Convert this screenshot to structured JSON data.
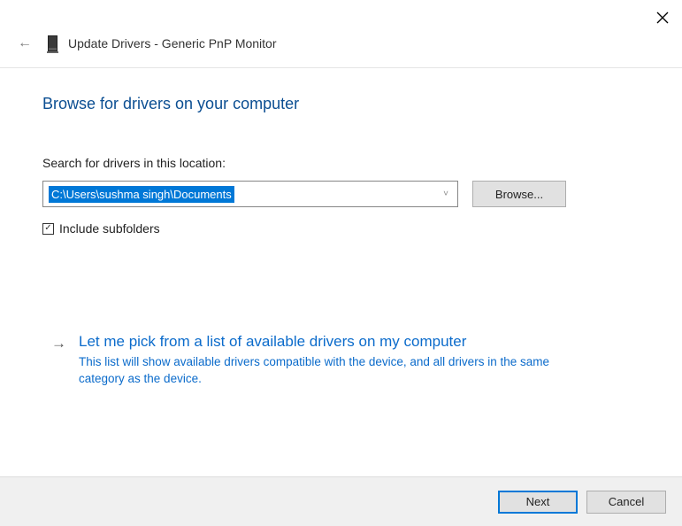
{
  "window": {
    "title": "Update Drivers - Generic PnP Monitor"
  },
  "page": {
    "title": "Browse for drivers on your computer",
    "search_label": "Search for drivers in this location:",
    "path_value": "C:\\Users\\sushma singh\\Documents",
    "browse_button": "Browse...",
    "include_subfolders_label": "Include subfolders",
    "include_subfolders_checked": true
  },
  "option": {
    "title": "Let me pick from a list of available drivers on my computer",
    "description": "This list will show available drivers compatible with the device, and all drivers in the same category as the device."
  },
  "footer": {
    "next": "Next",
    "cancel": "Cancel"
  }
}
